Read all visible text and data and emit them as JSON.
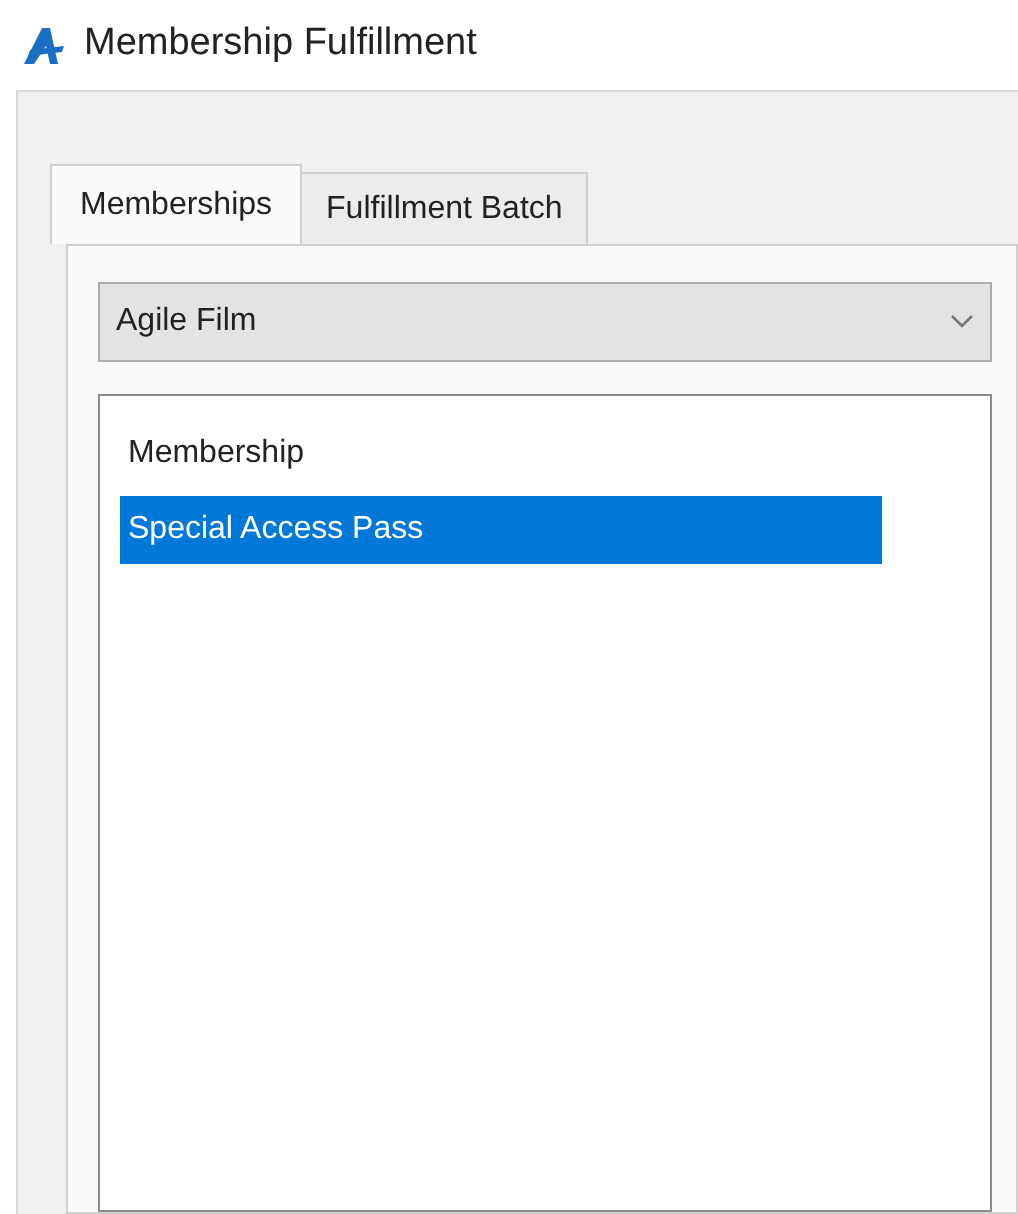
{
  "window": {
    "title": "Membership Fulfillment"
  },
  "tabs": [
    {
      "label": "Memberships",
      "selected": true
    },
    {
      "label": "Fulfillment Batch",
      "selected": false
    }
  ],
  "dropdown": {
    "value": "Agile Film"
  },
  "list": {
    "items": [
      {
        "label": "Membership",
        "selected": false
      },
      {
        "label": "Special Access Pass",
        "selected": true
      }
    ]
  }
}
